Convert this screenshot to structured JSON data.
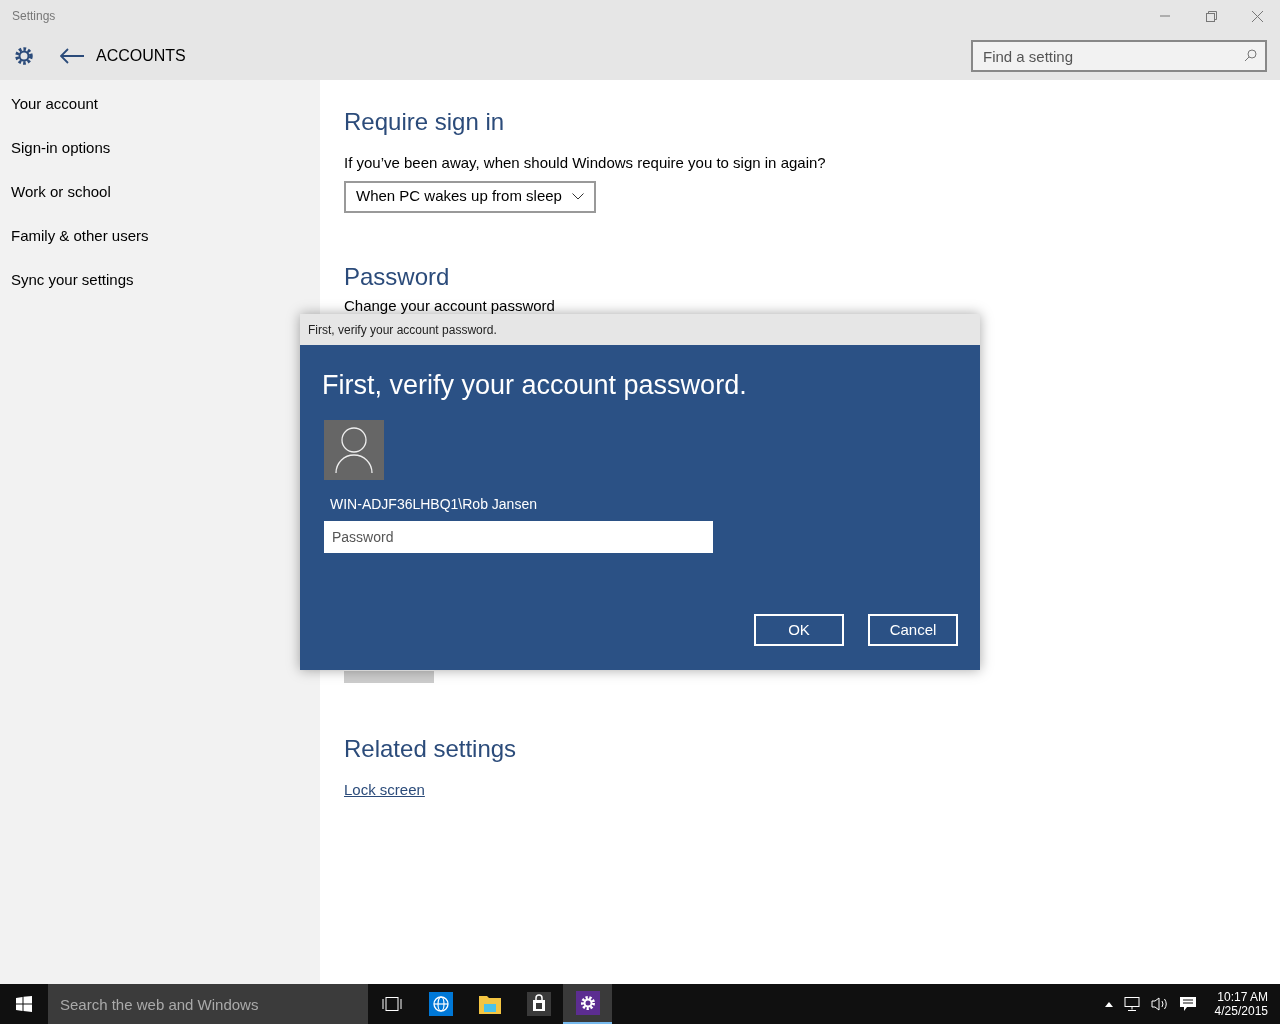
{
  "window": {
    "title": "Settings"
  },
  "header": {
    "title": "ACCOUNTS"
  },
  "search": {
    "placeholder": "Find a setting"
  },
  "sidebar": {
    "items": [
      {
        "label": "Your account"
      },
      {
        "label": "Sign-in options"
      },
      {
        "label": "Work or school"
      },
      {
        "label": "Family & other users"
      },
      {
        "label": "Sync your settings"
      }
    ]
  },
  "require_sign_in": {
    "heading": "Require sign in",
    "question": "If you’ve been away, when should Windows require you to sign in again?",
    "dropdown_value": "When PC wakes up from sleep"
  },
  "password": {
    "heading": "Password",
    "description": "Change your account password"
  },
  "related_settings": {
    "heading": "Related settings",
    "links": [
      "Lock screen"
    ]
  },
  "dialog": {
    "title": "First, verify your account password.",
    "heading": "First, verify your account password.",
    "account": "WIN-ADJF36LHBQ1\\Rob Jansen",
    "password_placeholder": "Password",
    "buttons": [
      "OK",
      "Cancel"
    ]
  },
  "taskbar": {
    "search_placeholder": "Search the web and Windows",
    "apps": [
      {
        "kind": "browser",
        "active": false
      },
      {
        "kind": "folder",
        "active": false
      },
      {
        "kind": "store",
        "active": false
      },
      {
        "kind": "settings",
        "active": true
      }
    ],
    "time": "10:17 AM",
    "date": "4/25/2015"
  }
}
